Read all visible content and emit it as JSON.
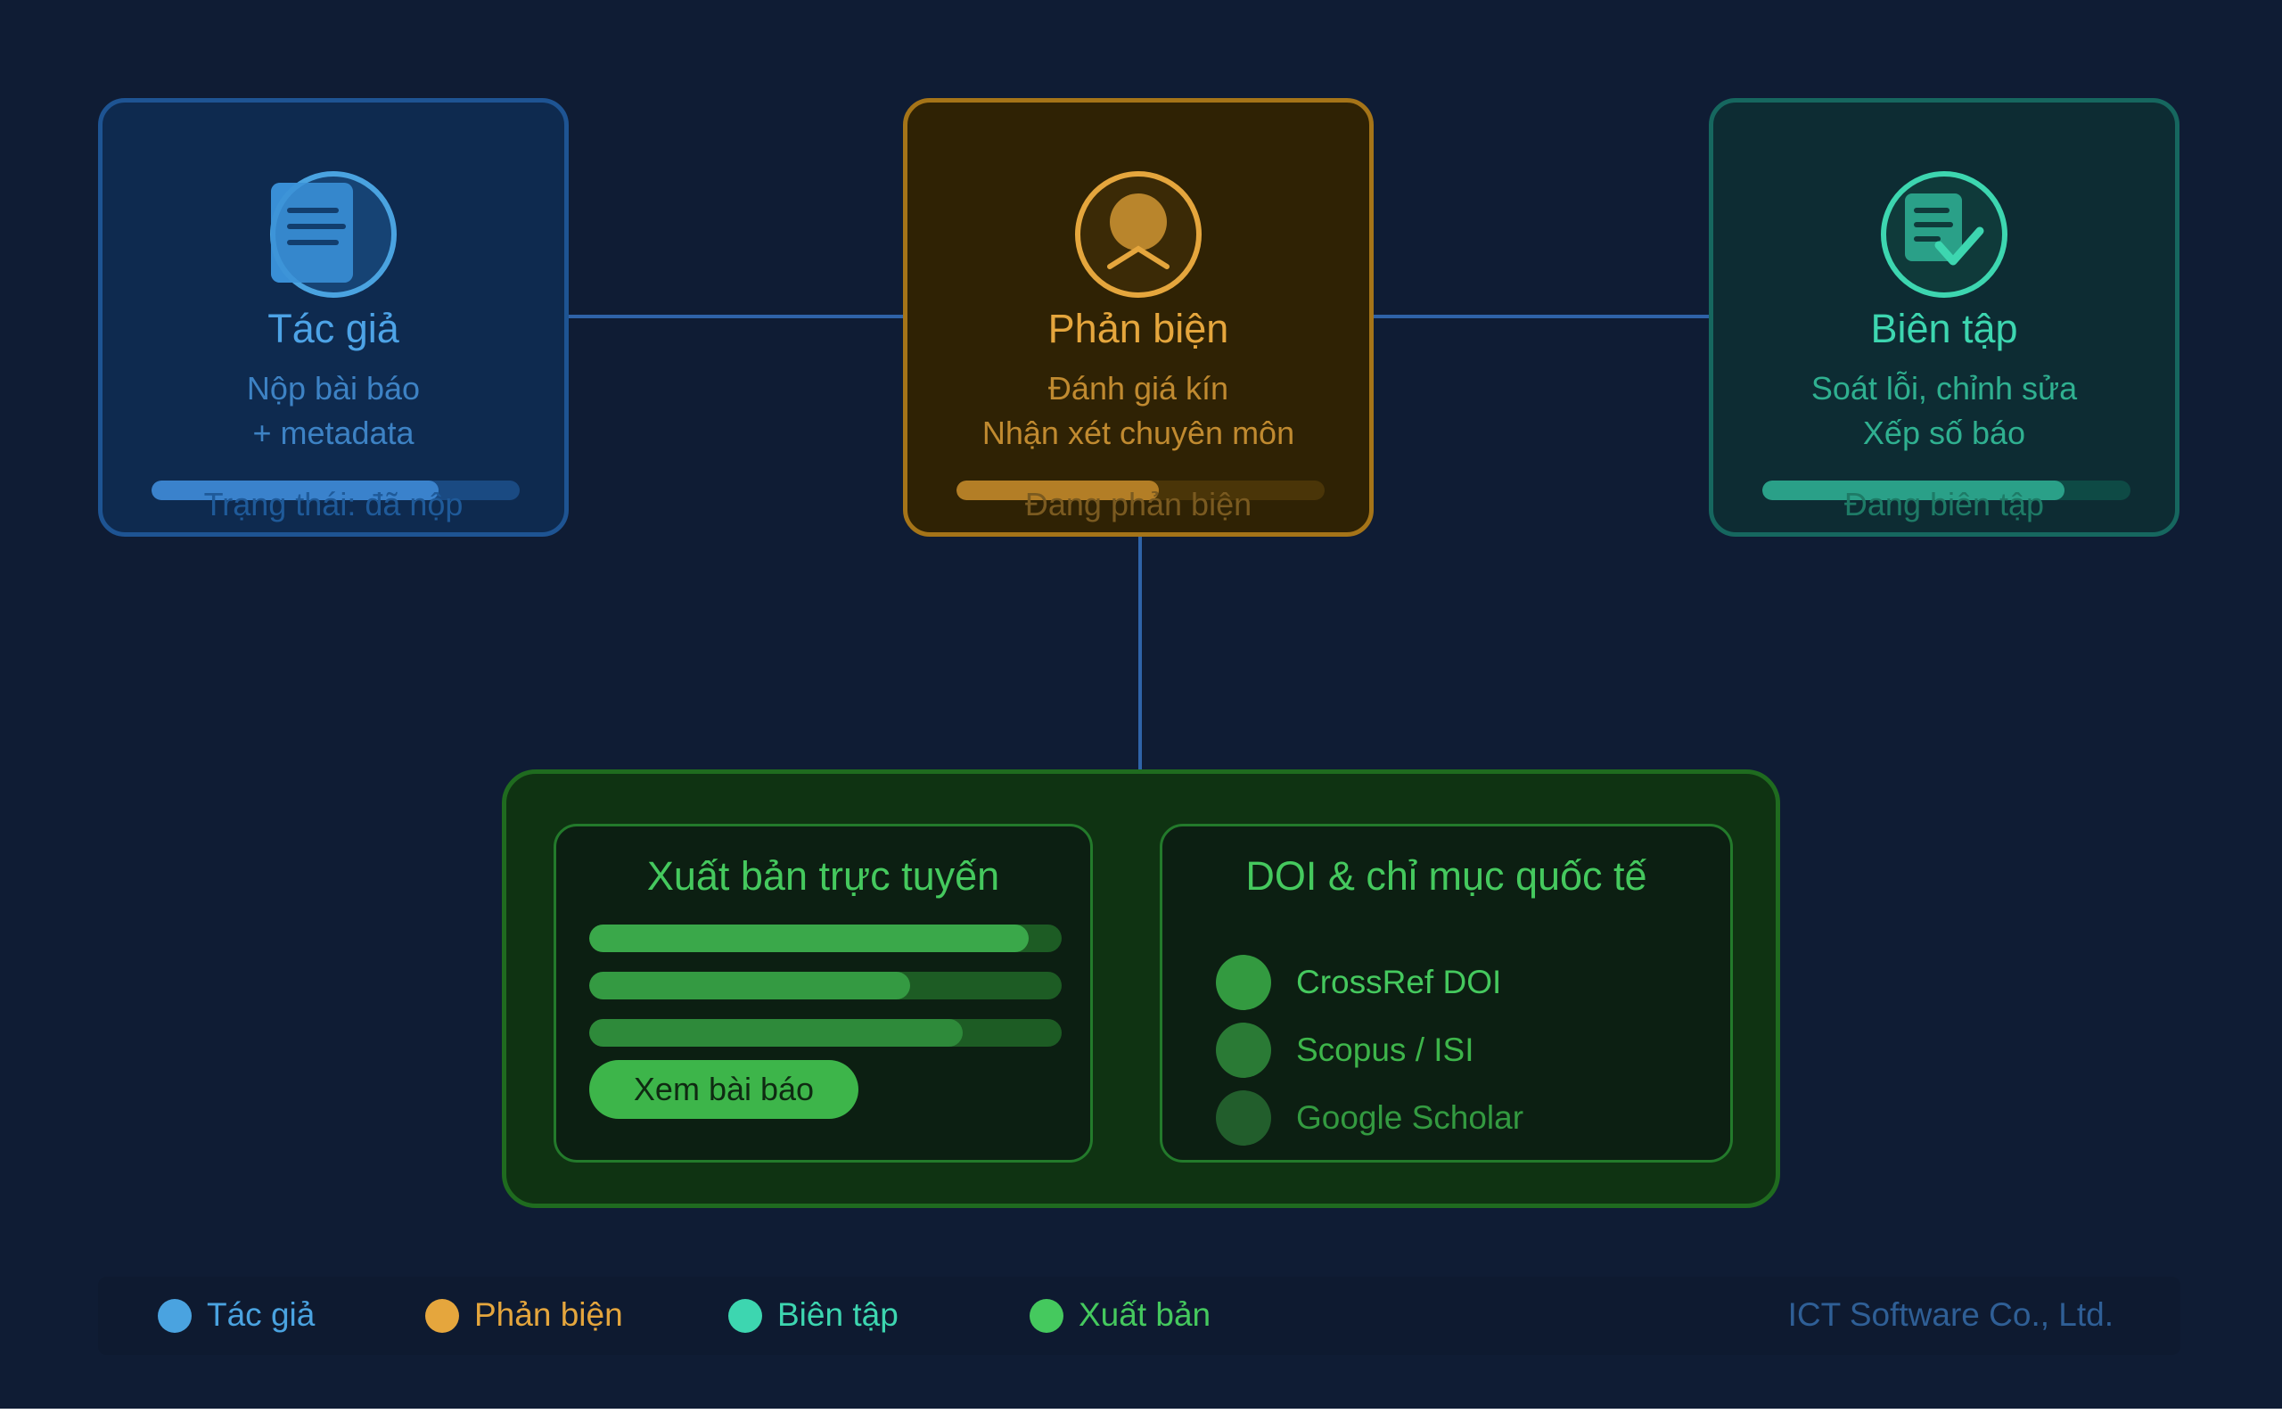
{
  "roles": {
    "author": {
      "title": "Tác giả",
      "desc1": "Nộp bài báo",
      "desc2": "+ metadata",
      "status": "Trạng thái: đã nộp",
      "progress": 0.78
    },
    "reviewer": {
      "title": "Phản biện",
      "desc1": "Đánh giá kín",
      "desc2": "Nhận xét chuyên môn",
      "status": "Đang phản biện",
      "progress": 0.55
    },
    "editor": {
      "title": "Biên tập",
      "desc1": "Soát lỗi, chỉnh sửa",
      "desc2": "Xếp số báo",
      "status": "Đang biên tập",
      "progress": 0.82
    }
  },
  "publish": {
    "online": {
      "title": "Xuất bản trực tuyến",
      "bars": [
        0.93,
        0.68,
        0.79
      ],
      "button_label": "Xem bài báo"
    },
    "doi": {
      "title": "DOI & chỉ mục quốc tế",
      "items": [
        {
          "label": "CrossRef DOI"
        },
        {
          "label": "Scopus / ISI"
        },
        {
          "label": "Google Scholar"
        }
      ]
    }
  },
  "legend": {
    "items": [
      {
        "label": "Tác giả",
        "color": "#4aa3e0"
      },
      {
        "label": "Phản biện",
        "color": "#e5a63d"
      },
      {
        "label": "Biên tập",
        "color": "#3dd6b0"
      },
      {
        "label": "Xuất bản",
        "color": "#45c95e"
      }
    ],
    "company": "ICT Software Co., Ltd."
  },
  "colors": {
    "background": "#0f1c34",
    "connector": "#2f63a8",
    "author": "#4aa3e0",
    "reviewer": "#e5a63d",
    "editor": "#3dd6b0",
    "publish": "#45c95e"
  }
}
